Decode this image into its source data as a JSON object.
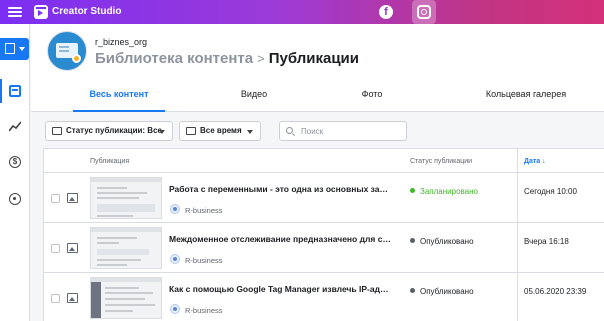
{
  "app": {
    "title": "Creator Studio"
  },
  "topbar": {
    "platforms": [
      "facebook-icon",
      "instagram-icon"
    ],
    "active_platform": "instagram"
  },
  "colors": {
    "accent": "#1877f2",
    "scheduled": "#42b72a",
    "published": "#5a5f66"
  },
  "header": {
    "account": "r_biznes_org",
    "breadcrumb_parent": "Библиотека контента",
    "breadcrumb_separator": ">",
    "breadcrumb_current": "Публикации"
  },
  "tabs": [
    {
      "label": "Весь контент",
      "active": true
    },
    {
      "label": "Видео",
      "active": false
    },
    {
      "label": "Фото",
      "active": false
    },
    {
      "label": "Кольцевая галерея",
      "active": false
    }
  ],
  "filters": {
    "status_label": "Статус публикации: Все",
    "time_label": "Все время",
    "search_placeholder": "Поиск"
  },
  "table": {
    "headers": {
      "publication": "Публикация",
      "status": "Статус публикации",
      "date": "Дата ↓"
    },
    "rows": [
      {
        "title": "Работа с переменными - это одна из основных задач ...",
        "page": "R-business",
        "status": "Запланировано",
        "status_color": "#42b72a",
        "date": "Сегодня 10:00"
      },
      {
        "title": "Междоменное отслеживание предназначено для связ...",
        "page": "R-business",
        "status": "Опубликовано",
        "status_color": "#5a5f66",
        "date": "Вчера 16:18"
      },
      {
        "title": "Как с помощью Google Tag Manager извлечь IP-адрес ...",
        "page": "R-business",
        "status": "Опубликовано",
        "status_color": "#5a5f66",
        "date": "05.06.2020 23:39"
      }
    ]
  }
}
